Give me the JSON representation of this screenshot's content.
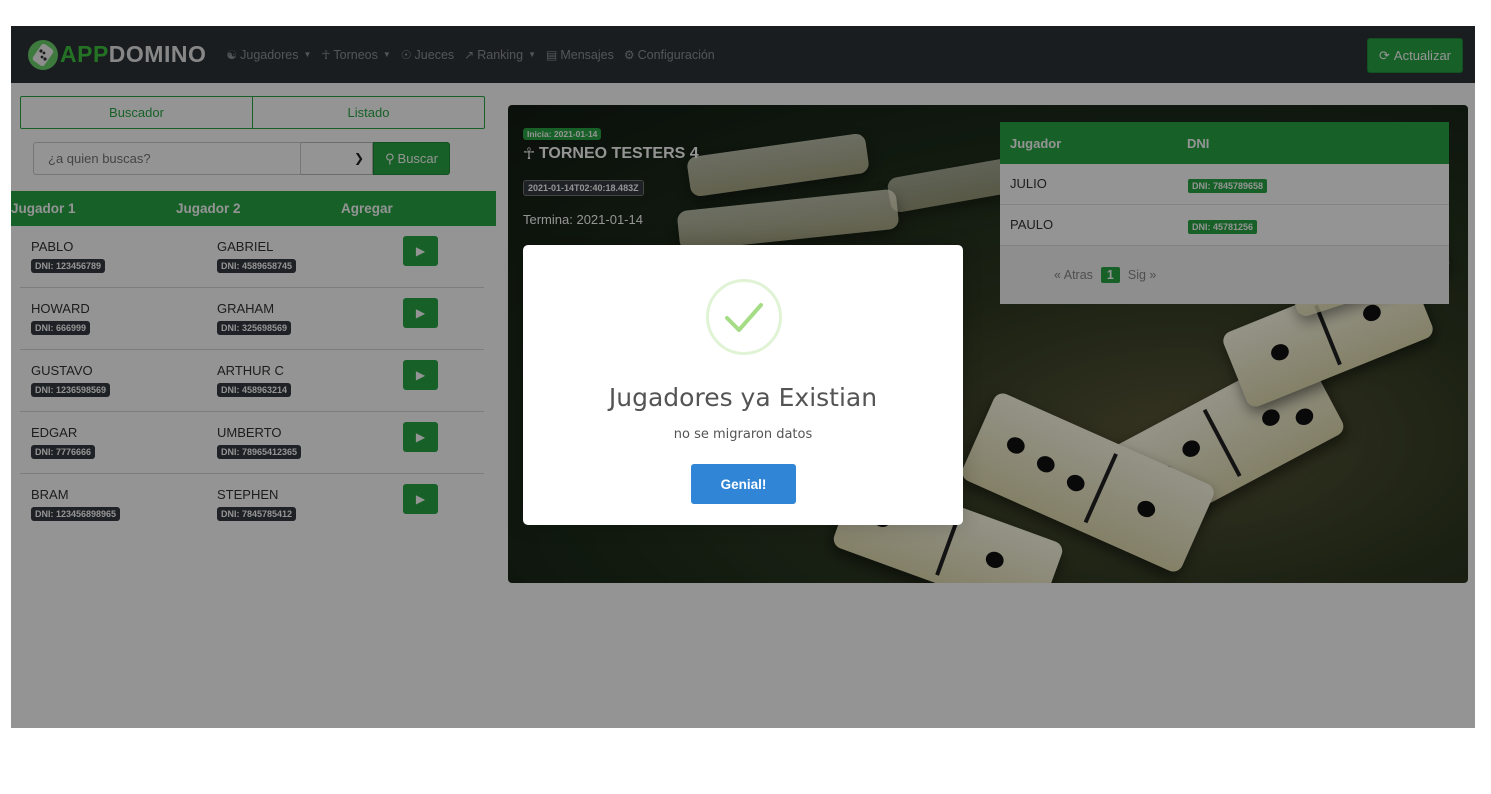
{
  "navbar": {
    "brand_prefix": "APP",
    "brand_suffix": "DOMINO",
    "items": [
      {
        "label": "Jugadores",
        "icon": "users-icon",
        "dropdown": true
      },
      {
        "label": "Torneos",
        "icon": "trophy-icon",
        "dropdown": true
      },
      {
        "label": "Jueces",
        "icon": "shield-icon",
        "dropdown": false
      },
      {
        "label": "Ranking",
        "icon": "chart-icon",
        "dropdown": true
      },
      {
        "label": "Mensajes",
        "icon": "message-icon",
        "dropdown": false
      },
      {
        "label": "Configuración",
        "icon": "settings-icon",
        "dropdown": false
      }
    ],
    "refresh_label": "Actualizar"
  },
  "left_panel": {
    "tabs": [
      "Buscador",
      "Listado"
    ],
    "search_placeholder": "¿a quien buscas?",
    "search_button": "Buscar",
    "columns": [
      "Jugador 1",
      "Jugador 2",
      "Agregar"
    ],
    "rows": [
      {
        "p1": "PABLO",
        "p1_dni": "DNI: 123456789",
        "p2": "GABRIEL",
        "p2_dni": "DNI: 4589658745"
      },
      {
        "p1": "HOWARD",
        "p1_dni": "DNI: 666999",
        "p2": "GRAHAM",
        "p2_dni": "DNI: 325698569"
      },
      {
        "p1": "GUSTAVO",
        "p1_dni": "DNI: 1236598569",
        "p2": "ARTHUR C",
        "p2_dni": "DNI: 458963214"
      },
      {
        "p1": "EDGAR",
        "p1_dni": "DNI: 7776666",
        "p2": "UMBERTO",
        "p2_dni": "DNI: 78965412365"
      },
      {
        "p1": "BRAM",
        "p1_dni": "DNI: 123456898965",
        "p2": "STEPHEN",
        "p2_dni": "DNI: 7845785412"
      }
    ]
  },
  "tournament": {
    "start": "Inicia: 2021-01-14",
    "title": "TORNEO TESTERS 4",
    "timestamp": "2021-01-14T02:40:18.483Z",
    "end": "Termina: 2021-01-14",
    "table_columns": [
      "Jugador",
      "DNI"
    ],
    "players": [
      {
        "name": "JULIO",
        "dni": "DNI: 7845789658"
      },
      {
        "name": "PAULO",
        "dni": "DNI: 45781256"
      }
    ],
    "pager": {
      "prev": "« Atras",
      "current": "1",
      "next": "Sig »"
    }
  },
  "modal": {
    "title": "Jugadores ya Existian",
    "text": "no se migraron datos",
    "button": "Genial!"
  },
  "colors": {
    "accent": "#28a745",
    "navbar": "#2d3238",
    "modal_button": "#3085d6"
  }
}
